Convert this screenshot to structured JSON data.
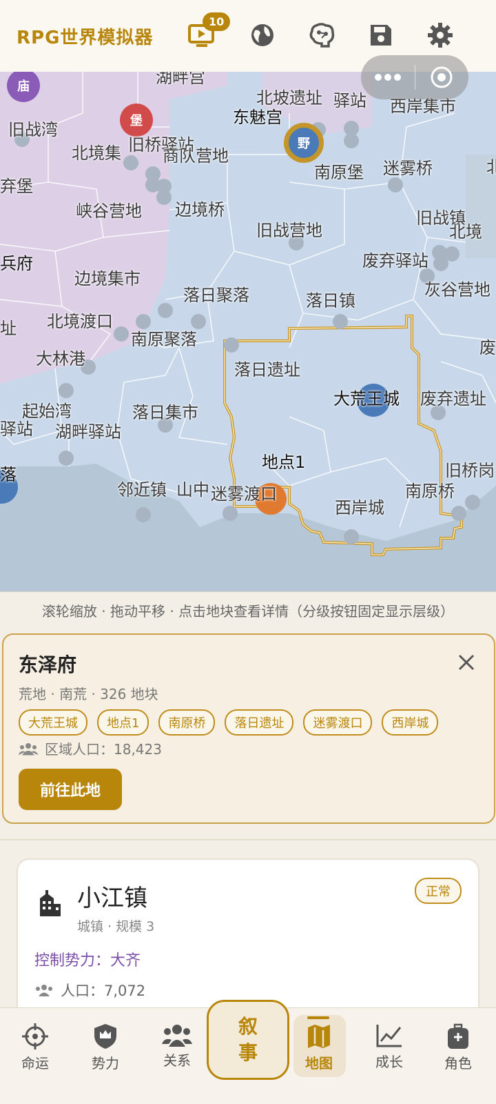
{
  "header": {
    "title": "RPG世界模拟器",
    "notification_count": "10",
    "icons": [
      "video-icon",
      "globe-icon",
      "brain-icon",
      "save-icon",
      "gear-icon"
    ]
  },
  "map": {
    "labels": {
      "l1": "湖畔宫",
      "l2": "北坡遗址",
      "l3": "驿站",
      "l4": "西岸集市",
      "l5": "东魅宫",
      "l6": "旧战湾",
      "l7": "北境集",
      "l8": "旧桥驿站",
      "l9": "商队营地",
      "l10": "南原堡",
      "l11": "迷雾桥",
      "l12": "弃堡",
      "l13": "峡谷营地",
      "l14": "边境桥",
      "l15": "旧战营地",
      "l16": "旧战镇",
      "l17": "北境",
      "l18": "兵府",
      "l19": "边境集市",
      "l20": "废弃驿站",
      "l21": "灰谷营地",
      "l22": "落日聚落",
      "l23": "落日镇",
      "l24": "北境渡口",
      "l25": "南原聚落",
      "l26": "址",
      "l27": "大林港",
      "l28": "落日遗址",
      "l29": "废",
      "l30": "大荒王城",
      "l31": "废弃遗址",
      "l32": "起始湾",
      "l33": "落日集市",
      "l34": "驿站",
      "l35": "湖畔驿站",
      "l36": "地点1",
      "l37": "落",
      "l38": "旧桥岗",
      "l39": "邻近镇",
      "l40": "山中",
      "l41": "迷雾渡口",
      "l42": "南原桥",
      "l43": "西岸城",
      "l44": "北"
    },
    "markers": {
      "temple": "庙",
      "fort": "堡",
      "wild": "野"
    }
  },
  "hint": "滚轮缩放 · 拖动平移 · 点击地块查看详情（分级按钮固定显示层级）",
  "region": {
    "name": "东泽府",
    "meta": "荒地 · 南荒 · 326 地块",
    "tags": [
      "大荒王城",
      "地点1",
      "南原桥",
      "落日遗址",
      "迷雾渡口",
      "西岸城"
    ],
    "population": "区域人口：18,423",
    "button": "前往此地"
  },
  "town": {
    "name": "小江镇",
    "sub": "城镇 · 规模 3",
    "status": "正常",
    "control": "控制势力：大齐",
    "population": "人口：7,072"
  },
  "nav": {
    "items": [
      "命运",
      "势力",
      "关系",
      "地图",
      "成长",
      "角色"
    ],
    "center": [
      "叙",
      "事"
    ],
    "active": "地图"
  },
  "colors": {
    "accent": "#b8860b",
    "territory_purple": "#ddd0e6",
    "territory_blue": "#c8d8ea",
    "sea": "#b5c7d6"
  }
}
